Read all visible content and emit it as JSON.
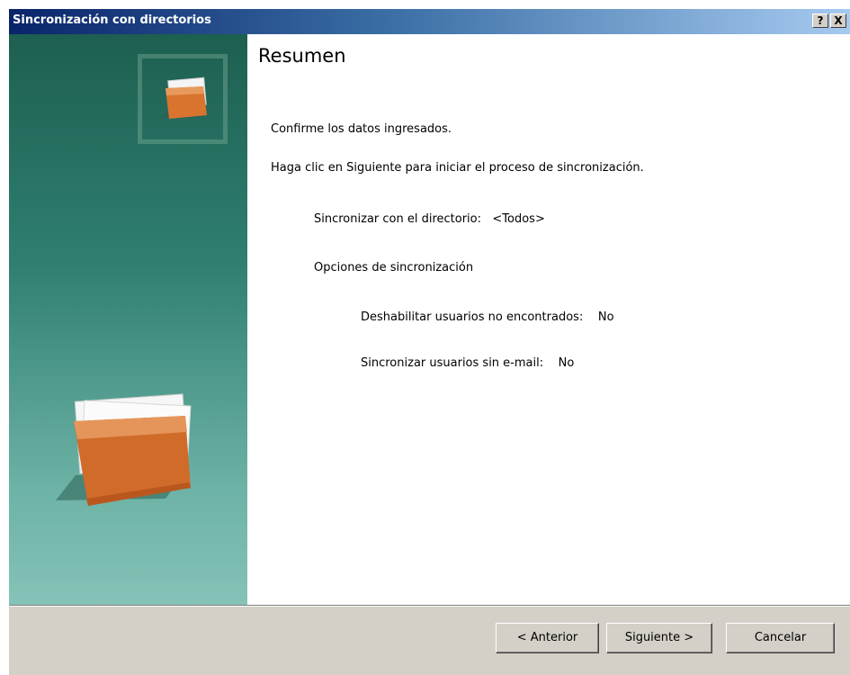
{
  "window": {
    "title": "Sincronización con directorios",
    "help_label": "?",
    "close_label": "X"
  },
  "page": {
    "heading": "Resumen",
    "confirm_text": "Confirme los datos ingresados.",
    "instruction_text": "Haga clic en Siguiente para iniciar el proceso de sincronización.",
    "directory_line": "Sincronizar con el directorio:   <Todos>",
    "options_heading": "Opciones de sincronización",
    "option_disable_users": "Deshabilitar usuarios no encontrados:    No",
    "option_sync_no_email": "Sincronizar usuarios sin e-mail:    No"
  },
  "buttons": {
    "back_label": "< Anterior",
    "next_label": "Siguiente >",
    "cancel_label": "Cancelar"
  },
  "icons": {
    "small_folder": "folder-icon",
    "large_folder": "folder-icon"
  },
  "colors": {
    "titlebar_start": "#0a246a",
    "panel_top": "#1d5f50",
    "panel_bottom": "#86c2b7",
    "folder": "#d2702c"
  }
}
